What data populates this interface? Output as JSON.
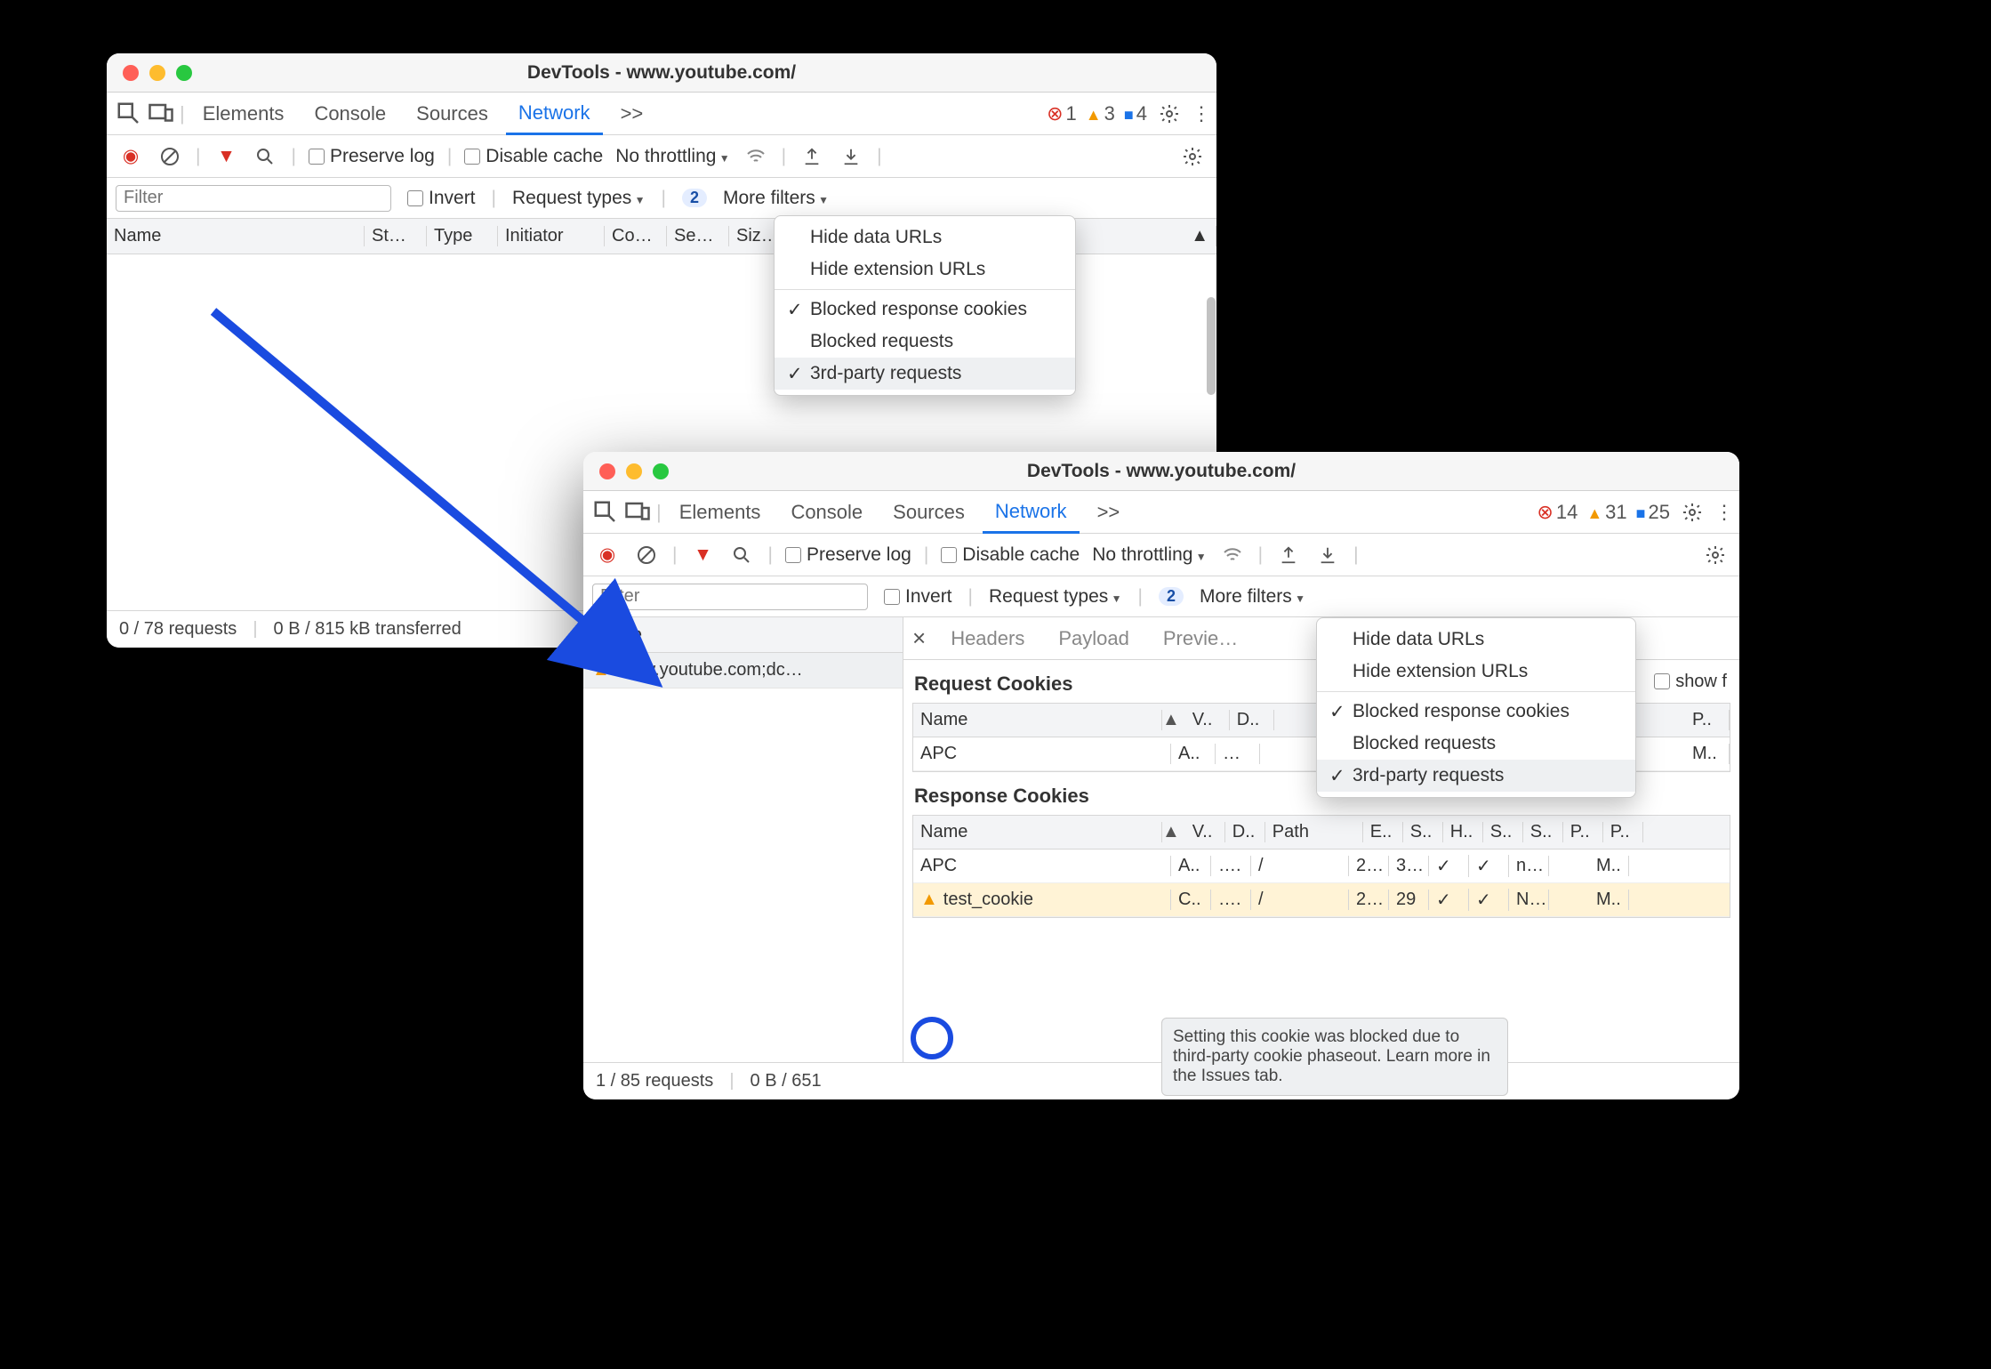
{
  "window1": {
    "title": "DevTools - www.youtube.com/",
    "tabs": [
      "Elements",
      "Console",
      "Sources",
      "Network"
    ],
    "active_tab": "Network",
    "overflow_glyph": ">>",
    "issues": {
      "errors": "1",
      "warnings": "3",
      "info": "4"
    },
    "toolbar": {
      "preserve": "Preserve log",
      "disable_cache": "Disable cache",
      "throttling": "No throttling"
    },
    "filterbar": {
      "placeholder": "Filter",
      "invert": "Invert",
      "request_types": "Request types",
      "more_filters": "More filters",
      "filter_count": "2"
    },
    "columns": [
      "Name",
      "St…",
      "Type",
      "Initiator",
      "Co…",
      "Se…",
      "Siz…"
    ],
    "menu": {
      "hide_data": "Hide data URLs",
      "hide_ext": "Hide extension URLs",
      "blocked_resp": "Blocked response cookies",
      "blocked_req": "Blocked requests",
      "third_party": "3rd-party requests"
    },
    "status": {
      "requests": "0 / 78 requests",
      "transfer": "0 B / 815 kB transferred"
    }
  },
  "window2": {
    "title": "DevTools - www.youtube.com/",
    "tabs": [
      "Elements",
      "Console",
      "Sources",
      "Network"
    ],
    "active_tab": "Network",
    "overflow_glyph": ">>",
    "issues": {
      "errors": "14",
      "warnings": "31",
      "info": "25"
    },
    "toolbar": {
      "preserve": "Preserve log",
      "disable_cache": "Disable cache",
      "throttling": "No throttling"
    },
    "filterbar": {
      "placeholder": "Filter",
      "invert": "Invert",
      "request_types": "Request types",
      "more_filters": "More filters",
      "filter_count": "2"
    },
    "left": {
      "name_header": "Name",
      "row": "www.youtube.com;dc…"
    },
    "detail_tabs": [
      "Headers",
      "Payload",
      "Previe…"
    ],
    "request_cookies": {
      "title": "Request Cookies",
      "show_filtered": "show f",
      "headers": [
        "Name",
        "V..",
        "D..",
        "",
        "",
        "",
        "",
        "",
        "",
        "P.."
      ],
      "rows": [
        [
          "APC",
          "A..",
          "…",
          "",
          "",
          "",
          "",
          "",
          "",
          "M.."
        ]
      ]
    },
    "response_cookies": {
      "title": "Response Cookies",
      "headers": [
        "Name",
        "V..",
        "D..",
        "Path",
        "E..",
        "S..",
        "H..",
        "S..",
        "S..",
        "P..",
        "P.."
      ],
      "rows": [
        [
          "APC",
          "A..",
          "….",
          "/",
          "2…",
          "3…",
          "✓",
          "✓",
          "n…",
          "",
          "M.."
        ],
        [
          "test_cookie",
          "C..",
          "….",
          "/",
          "2…",
          "29",
          "✓",
          "✓",
          "N…",
          "",
          "M.."
        ]
      ]
    },
    "menu": {
      "hide_data": "Hide data URLs",
      "hide_ext": "Hide extension URLs",
      "blocked_resp": "Blocked response cookies",
      "blocked_req": "Blocked requests",
      "third_party": "3rd-party requests"
    },
    "tooltip": "Setting this cookie was blocked due to third-party cookie phaseout. Learn more in the Issues tab.",
    "status": {
      "requests": "1 / 85 requests",
      "transfer": "0 B / 651"
    }
  }
}
